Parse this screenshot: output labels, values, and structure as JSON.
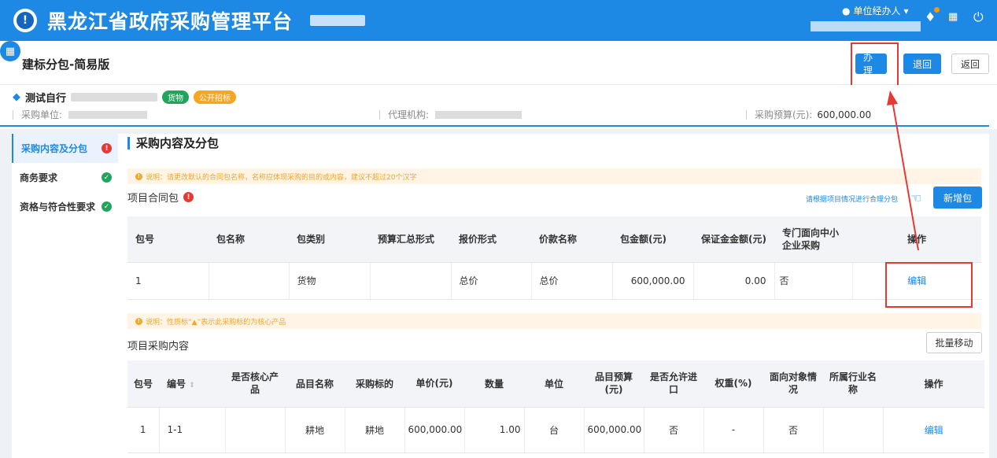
{
  "header": {
    "app_title": "黑龙江省政府采购管理平台",
    "user_role": "单位经办人"
  },
  "page": {
    "title": "建标分包-简易版",
    "buttons": {
      "handle": "办理",
      "send_back": "退回",
      "back": "返回"
    }
  },
  "project": {
    "name_prefix": "测试自行",
    "tags": [
      "货物",
      "公开招标"
    ],
    "purchaser_label": "采购单位:",
    "agency_label": "代理机构:",
    "budget_label": "采购预算(元):",
    "budget_value": "600,000.00"
  },
  "sidebar": {
    "items": [
      {
        "label": "采购内容及分包",
        "status": "error"
      },
      {
        "label": "商务要求",
        "status": "ok"
      },
      {
        "label": "资格与符合性要求",
        "status": "ok"
      }
    ]
  },
  "main": {
    "section_title": "采购内容及分包",
    "notice1": "说明：请更改默认的合同包名称，名称应体现采购的目的或内容，建议不超过20个汉字",
    "packages_label": "项目合同包",
    "hint": "请根据项目情况进行合理分包",
    "add_package": "新增包",
    "packages_table": {
      "columns": [
        "包号",
        "包名称",
        "包类别",
        "预算汇总形式",
        "报价形式",
        "价款名称",
        "包金额(元)",
        "保证金金额(元)",
        "专门面向中小企业采购",
        "操作"
      ],
      "rows": [
        [
          "1",
          "",
          "货物",
          "",
          "总价",
          "总价",
          "600,000.00",
          "0.00",
          "否",
          "编辑"
        ]
      ]
    },
    "notice2": "说明：性质标“▲”表示此采购标的为核心产品",
    "content_label": "项目采购内容",
    "batch_move": "批量移动",
    "content_table": {
      "columns": [
        "包号",
        "编号",
        "是否核心产品",
        "品目名称",
        "采购标的",
        "单价(元)",
        "数量",
        "单位",
        "品目预算(元)",
        "是否允许进口",
        "权重(%)",
        "面向对象情况",
        "所属行业名称",
        "操作"
      ],
      "rows": [
        [
          "1",
          "1-1",
          "",
          "耕地",
          "耕地",
          "600,000.00",
          "1.00",
          "台",
          "600,000.00",
          "否",
          "-",
          "否",
          "",
          "编辑"
        ]
      ]
    }
  }
}
